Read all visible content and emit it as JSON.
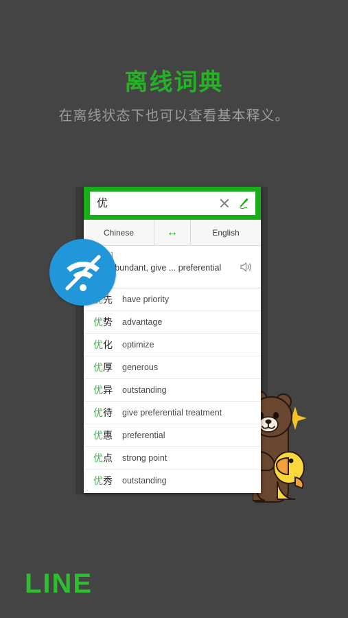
{
  "header": {
    "title": "离线词典",
    "subtitle": "在离线状态下也可以查看基本释义。"
  },
  "brand": {
    "logo_text": "LINE",
    "brand_color": "#2fbe2f"
  },
  "colors": {
    "background": "#444444",
    "green": "#19ae19",
    "title_green": "#25b325",
    "subtitle_gray": "#9b9b9b",
    "offline_blue": "#2196d9",
    "card_white": "#ffffff"
  },
  "app": {
    "search": {
      "value": "优",
      "placeholder": "",
      "clear_icon": "close-x-icon",
      "handwriting_icon": "pen-icon"
    },
    "language_bar": {
      "source": "Chinese",
      "swap_icon": "swap-arrows-icon",
      "swap_symbol": "↔",
      "target": "English"
    },
    "headword": {
      "pinyin": "[yōu]",
      "definition": "ent, abundant, give ... preferential",
      "audio_icon": "speaker-icon"
    },
    "results": [
      {
        "hanzi_green": "优",
        "hanzi_black": "先",
        "english": "have priority"
      },
      {
        "hanzi_green": "优",
        "hanzi_black": "势",
        "english": "advantage"
      },
      {
        "hanzi_green": "优",
        "hanzi_black": "化",
        "english": "optimize"
      },
      {
        "hanzi_green": "优",
        "hanzi_black": "厚",
        "english": "generous"
      },
      {
        "hanzi_green": "优",
        "hanzi_black": "异",
        "english": "outstanding"
      },
      {
        "hanzi_green": "优",
        "hanzi_black": "待",
        "english": "give preferential treatment"
      },
      {
        "hanzi_green": "优",
        "hanzi_black": "惠",
        "english": "preferential"
      },
      {
        "hanzi_green": "优",
        "hanzi_black": "点",
        "english": "strong point"
      },
      {
        "hanzi_green": "优",
        "hanzi_black": "秀",
        "english": "outstanding"
      }
    ]
  },
  "offline_badge": {
    "icon": "wifi-off-icon"
  },
  "mascots": {
    "bear": "brown-bear-character",
    "duck": "sally-duck-character",
    "sparkle": "sparkle-icon"
  }
}
